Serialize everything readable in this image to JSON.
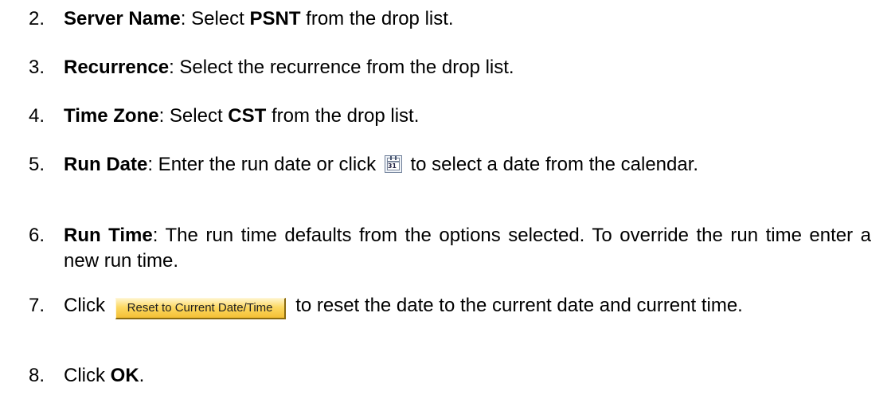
{
  "steps": [
    {
      "number": "2.",
      "term": "Server Name",
      "sep": ":  Select ",
      "value": "PSNT",
      "rest": " from the drop list."
    },
    {
      "number": "3.",
      "term": "Recurrence",
      "rest": ":  Select the recurrence from the drop list."
    },
    {
      "number": "4.",
      "term": "Time Zone",
      "sep": ":  Select ",
      "value": "CST",
      "rest": " from the drop list."
    },
    {
      "number": "5.",
      "term": "Run Date",
      "before_icon": ":  Enter the run date or click",
      "icon": "calendar-icon",
      "icon_text": "31",
      "after_icon": "to select a date from the calendar."
    },
    {
      "number": "6.",
      "term": "Run Time",
      "rest": ":  The run time defaults from the options selected.  To override the run time enter a new run time."
    },
    {
      "number": "7.",
      "before_button": "Click",
      "button_label": "Reset to Current Date/Time",
      "after_button": "to reset the date to the current date and current time."
    },
    {
      "number": "8.",
      "before_bold": "Click ",
      "bold": "OK",
      "rest": "."
    }
  ],
  "colors": {
    "button_face": "#fcd862",
    "button_text": "#222222",
    "text": "#000000"
  }
}
